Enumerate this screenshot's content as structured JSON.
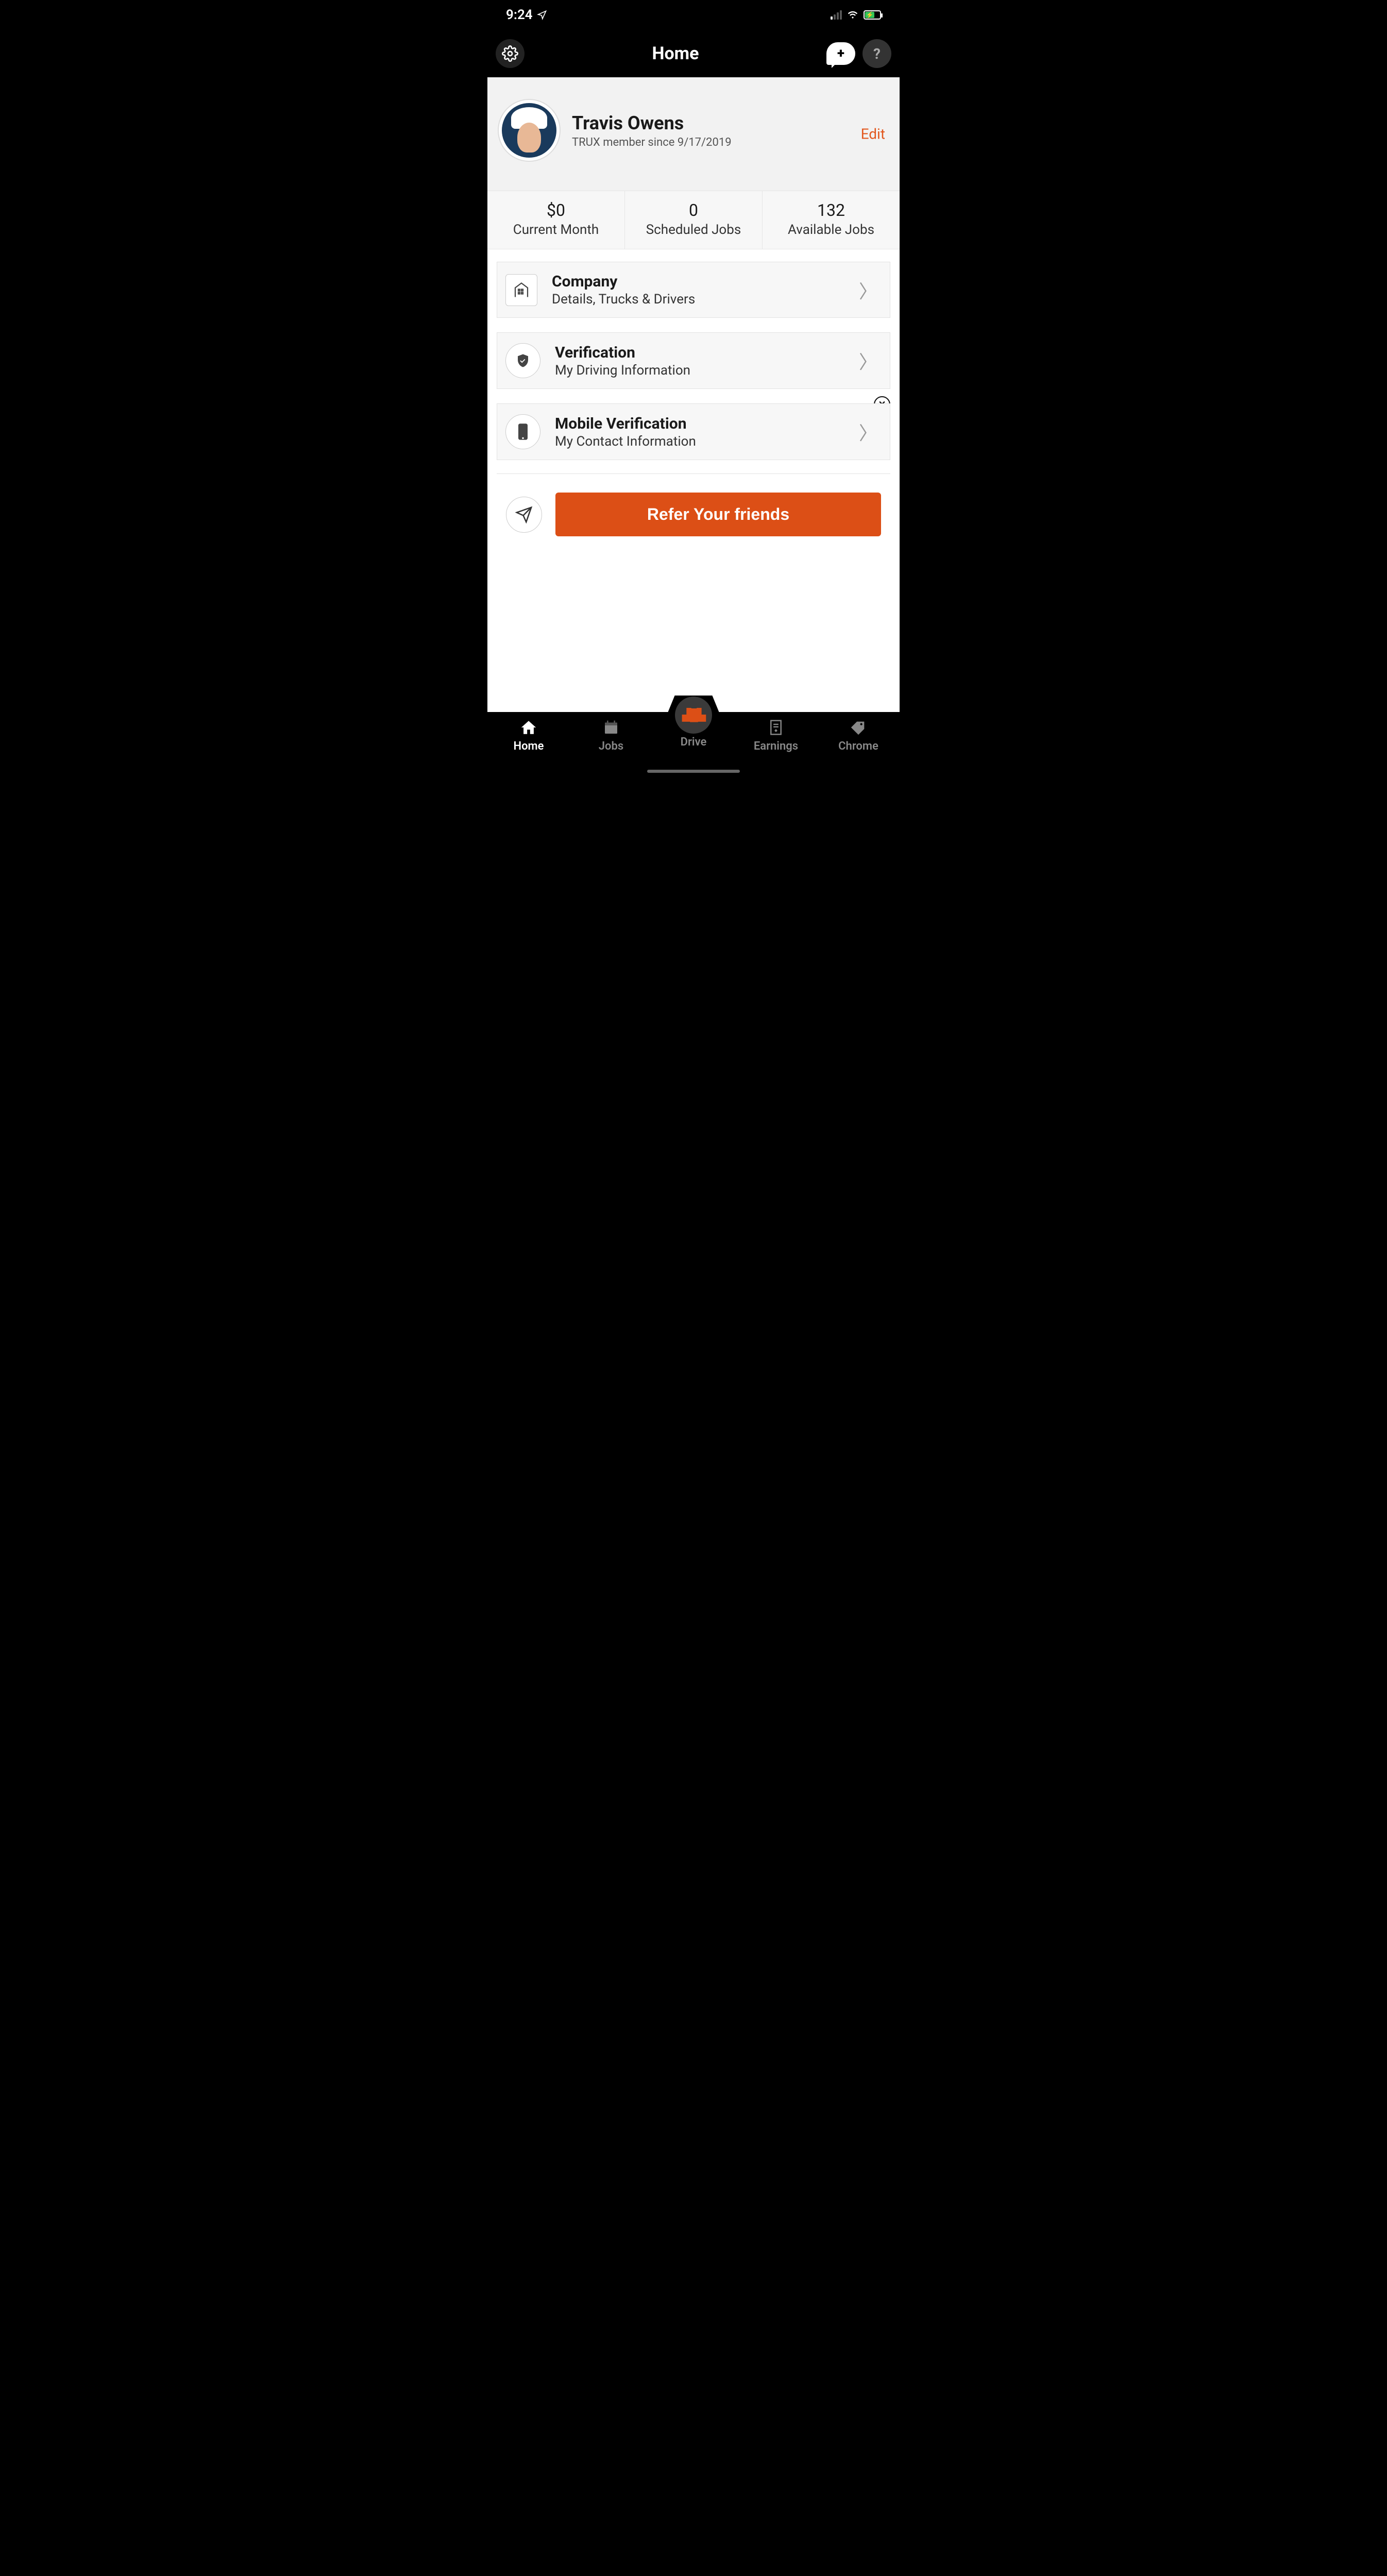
{
  "statusBar": {
    "time": "9:24"
  },
  "header": {
    "title": "Home"
  },
  "profile": {
    "name": "Travis Owens",
    "memberSince": "TRUX member since  9/17/2019",
    "editLabel": "Edit"
  },
  "stats": {
    "currentMonth": {
      "value": "$0",
      "label": "Current Month"
    },
    "scheduled": {
      "value": "0",
      "label": "Scheduled Jobs"
    },
    "available": {
      "value": "132",
      "label": "Available Jobs"
    }
  },
  "menu": {
    "company": {
      "title": "Company",
      "subtitle": "Details, Trucks & Drivers"
    },
    "verification": {
      "title": "Verification",
      "subtitle": "My Driving Information"
    },
    "mobile": {
      "title": "Mobile Verification",
      "subtitle": "My Contact Information"
    }
  },
  "refer": {
    "button": "Refer Your friends"
  },
  "tabs": {
    "home": "Home",
    "jobs": "Jobs",
    "drive": "Drive",
    "earnings": "Earnings",
    "chrome": "Chrome"
  }
}
